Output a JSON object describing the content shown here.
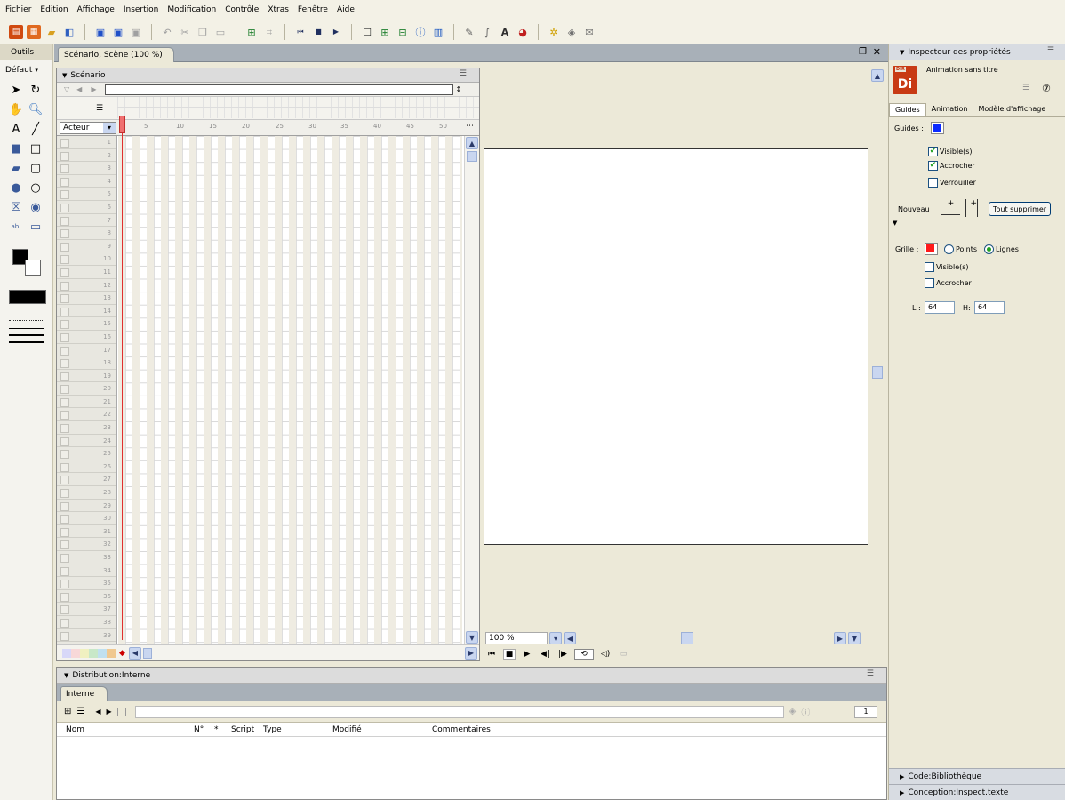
{
  "menu": [
    "Fichier",
    "Edition",
    "Affichage",
    "Insertion",
    "Modification",
    "Contrôle",
    "Xtras",
    "Fenêtre",
    "Aide"
  ],
  "tools": {
    "title": "Outils",
    "mode": "Défaut"
  },
  "document": {
    "tab": "Scénario, Scène (100 %)"
  },
  "score": {
    "title": "Scénario",
    "channel_dropdown": "Acteur",
    "frame_numbers": [
      "5",
      "10",
      "15",
      "20",
      "25",
      "30",
      "35",
      "40",
      "45",
      "50"
    ],
    "channels": [
      "1",
      "2",
      "3",
      "4",
      "5",
      "6",
      "7",
      "8",
      "9",
      "10",
      "11",
      "12",
      "13",
      "14",
      "15",
      "16",
      "17",
      "18",
      "19",
      "20",
      "21",
      "22",
      "23",
      "24",
      "25",
      "26",
      "27",
      "28",
      "29",
      "30",
      "31",
      "32",
      "33",
      "34",
      "35",
      "36",
      "37",
      "38",
      "39"
    ]
  },
  "stage": {
    "zoom": "100 %"
  },
  "cast": {
    "title": "Distribution:Interne",
    "tab": "Interne",
    "cast_number": "1",
    "columns": [
      "Nom",
      "N°",
      "*",
      "Script",
      "Type",
      "Modifié",
      "Commentaires"
    ]
  },
  "inspector": {
    "title": "Inspecteur des propriétés",
    "movie_name": "Animation sans titre",
    "tabs": [
      "Guides",
      "Animation",
      "Modèle d'affichage"
    ],
    "guides_label": "Guides :",
    "visible": "Visible(s)",
    "snap": "Accrocher",
    "lock": "Verrouiller",
    "new_label": "Nouveau :",
    "delete_all": "Tout supprimer",
    "grid_label": "Grille :",
    "points": "Points",
    "lines": "Lignes",
    "grid_visible": "Visible(s)",
    "grid_snap": "Accrocher",
    "w_label": "L :",
    "w_value": "64",
    "h_label": "H:",
    "h_value": "64",
    "guide_color": "#0a2aff",
    "grid_color": "#ff1a1a"
  },
  "panels": {
    "library": "Code:Bibliothèque",
    "text_inspector": "Conception:Inspect.texte"
  }
}
